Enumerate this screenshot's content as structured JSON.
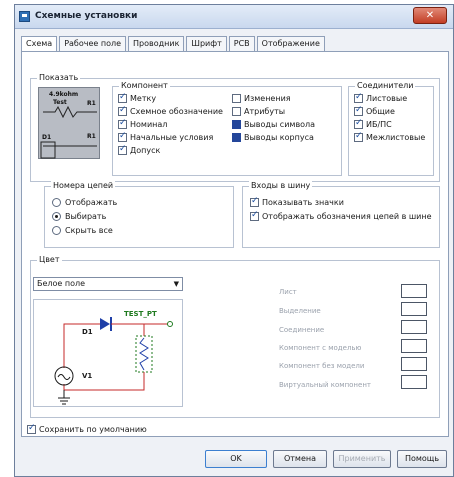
{
  "window": {
    "title": "Схемные установки",
    "close_label": "✕"
  },
  "tabs": [
    "Схема",
    "Рабочее поле",
    "Проводник",
    "Шрифт",
    "PCB",
    "Отображение"
  ],
  "show_group": {
    "title": "Показать",
    "preview": {
      "part": "R1",
      "part_label": "4.9kohm",
      "part_label2": "Test",
      "part_ref": "R1",
      "ref2": "R1",
      "ref3": "D1"
    }
  },
  "component_group": {
    "title": "Компонент",
    "items": [
      {
        "label": "Метку",
        "state": "checked"
      },
      {
        "label": "Схемное обозначение",
        "state": "checked"
      },
      {
        "label": "Номинал",
        "state": "checked"
      },
      {
        "label": "Начальные условия",
        "state": "checked"
      },
      {
        "label": "Допуск",
        "state": "checked"
      },
      {
        "label": "Изменения",
        "state": "unchecked"
      },
      {
        "label": "Атрибуты",
        "state": "unchecked"
      },
      {
        "label": "Выводы символа",
        "state": "indeterminate"
      },
      {
        "label": "Выводы корпуса",
        "state": "indeterminate"
      }
    ]
  },
  "connectors_group": {
    "title": "Соединители",
    "items": [
      {
        "label": "Листовые",
        "state": "checked"
      },
      {
        "label": "Общие",
        "state": "checked"
      },
      {
        "label": "ИБ/ПС",
        "state": "checked"
      },
      {
        "label": "Межлистовые",
        "state": "checked"
      }
    ]
  },
  "net_numbers_group": {
    "title": "Номера цепей",
    "options": [
      {
        "label": "Отображать",
        "selected": false
      },
      {
        "label": "Выбирать",
        "selected": true
      },
      {
        "label": "Скрыть все",
        "selected": false
      }
    ]
  },
  "bus_inputs_group": {
    "title": "Входы в шину",
    "items": [
      {
        "label": "Показывать значки",
        "state": "checked"
      },
      {
        "label": "Отображать обозначения цепей в шине",
        "state": "checked"
      }
    ]
  },
  "color_group": {
    "title": "Цвет",
    "scheme_selected": "Белое поле",
    "circuit": {
      "probe": "TEST_PT",
      "diode": "D1",
      "source": "V1"
    },
    "items": [
      {
        "label": "Лист",
        "color": "#ffffff"
      },
      {
        "label": "Выделение",
        "color": "#ffffff"
      },
      {
        "label": "Соединение",
        "color": "#ffffff"
      },
      {
        "label": "Компонент с моделью",
        "color": "#ffffff"
      },
      {
        "label": "Компонент без модели",
        "color": "#ffffff"
      },
      {
        "label": "Виртуальный компонент",
        "color": "#ffffff"
      }
    ]
  },
  "save_default": {
    "label": "Сохранить по умолчанию",
    "state": "checked"
  },
  "buttons": {
    "ok": "OK",
    "cancel": "Отмена",
    "apply": "Применить",
    "help": "Помощь"
  },
  "colors": {
    "diode": "#1f3fa8",
    "probe": "#1f7a1f",
    "wire": "#c62a2a",
    "ground": "#1a1a1a"
  }
}
